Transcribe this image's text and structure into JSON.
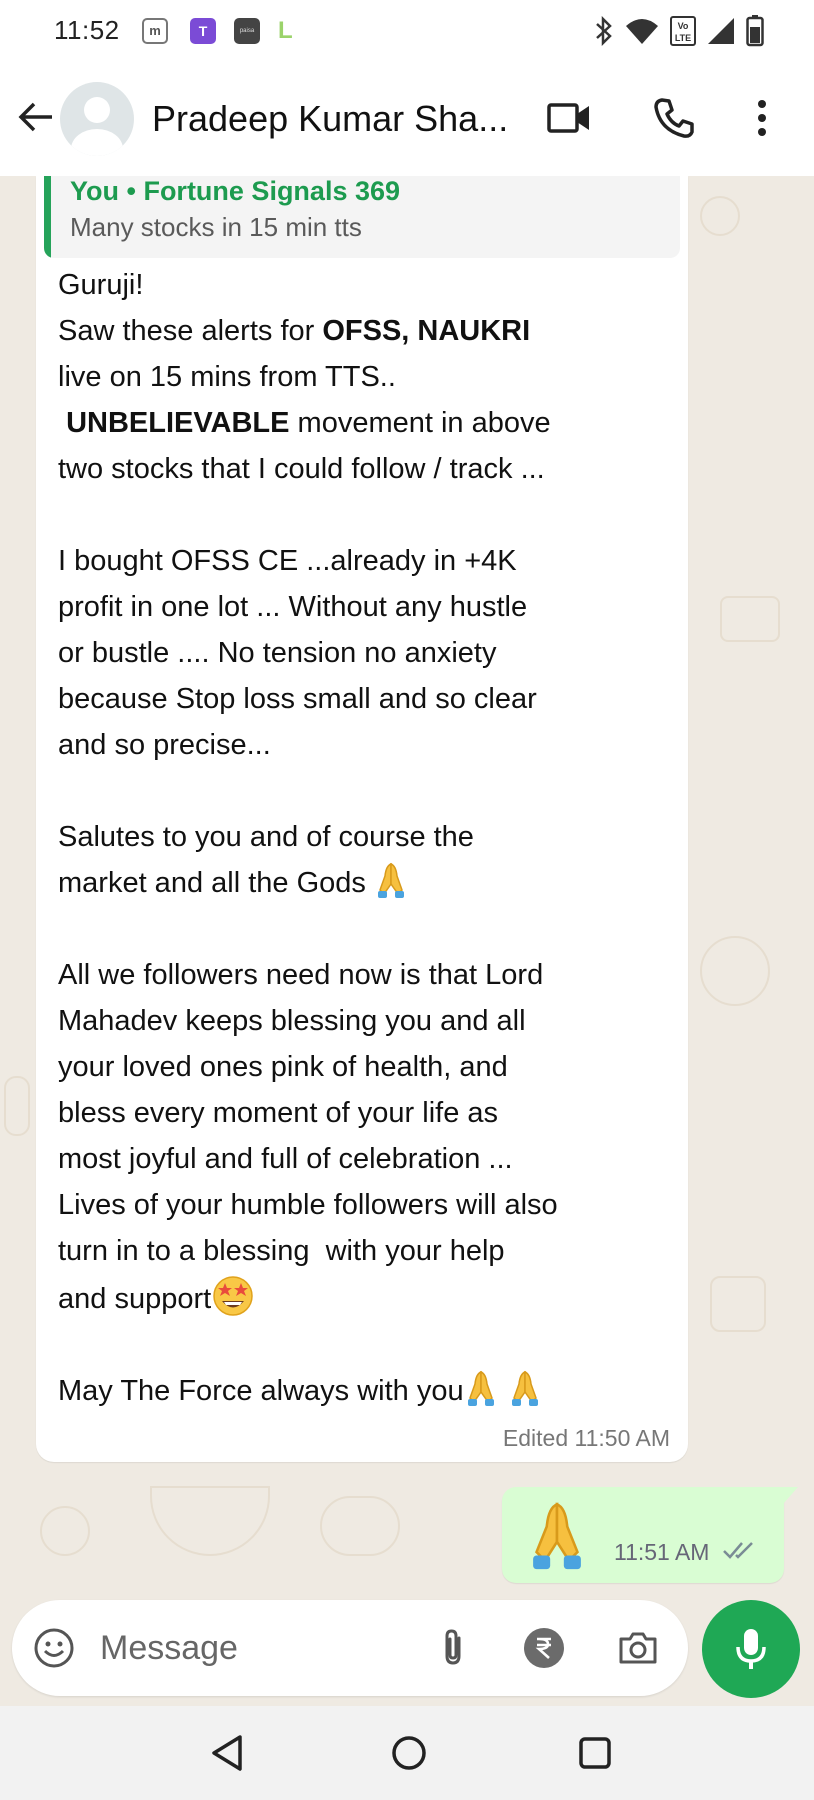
{
  "status_bar": {
    "time": "11:52",
    "app_icons": [
      "m",
      "T",
      "paisa",
      "L"
    ],
    "volte_label": "Vo LTE"
  },
  "header": {
    "contact_name": "Pradeep Kumar Sha...",
    "icons": [
      "back-arrow-icon",
      "video-call-icon",
      "voice-call-icon",
      "more-options-icon"
    ]
  },
  "incoming_message": {
    "quote": {
      "title": "You • Fortune Signals 369",
      "text": "Many stocks in 15 min tts"
    },
    "paragraphs": {
      "p1_line1": "Guruji!",
      "p1_line2_pre": "Saw these alerts for ",
      "p1_line2_bold": "OFSS, NAUKRI",
      "p1_line3": "live on 15 mins from TTS..",
      "p1_line4_bold": "UNBELIEVABLE",
      "p1_line4_post": " movement in above",
      "p1_line5": "two stocks that I could follow / track ...",
      "p2": "I bought OFSS CE ...already in +4K\nprofit in one lot ... Without any hustle\nor bustle .... No tension no anxiety\nbecause Stop loss small and so clear\nand so precise...",
      "p3_line1": "Salutes to you and of course the",
      "p3_line2": "market and all the Gods ",
      "p4": "All we followers need now is that Lord\nMahadev keeps blessing you and all\nyour loved ones pink of health, and\nbless every moment of your life as\nmost joyful and full of celebration ...\nLives of your humble followers will also\nturn in to a blessing  with your help\n",
      "p4_end": "and support",
      "p5": "May The Force always with you"
    },
    "edited_time": "Edited 11:50 AM"
  },
  "outgoing_message": {
    "emoji": "folded-hands",
    "time": "11:51 AM",
    "status": "read"
  },
  "composer": {
    "placeholder": "Message"
  },
  "nav": [
    "back",
    "home",
    "recents"
  ],
  "colors": {
    "accent_green": "#1fa855",
    "quote_green": "#1d9b4f",
    "outgoing_bubble": "#d9fdd3",
    "chat_background": "#efeae2"
  }
}
